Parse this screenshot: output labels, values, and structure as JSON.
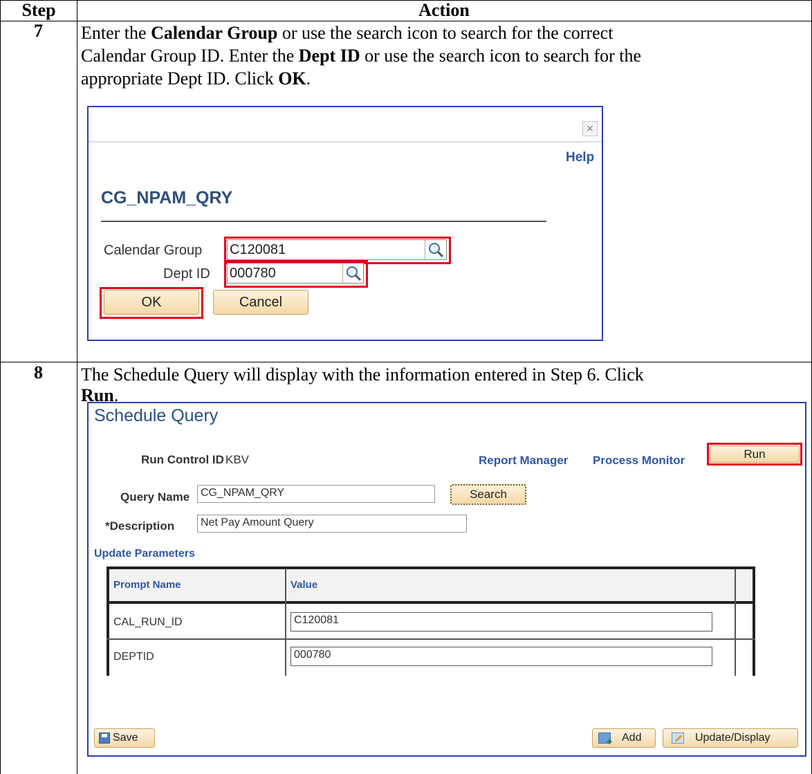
{
  "table": {
    "col_step": "Step",
    "col_action": "Action"
  },
  "step7": {
    "number": "7",
    "line1_a": "Enter the ",
    "line1_b": "Calendar Group",
    "line1_c": " or use the search icon to search for the correct",
    "line2_a": "Calendar Group ID.  Enter the ",
    "line2_b": "Dept ID",
    "line2_c": " or use the search icon to search for the",
    "line3_a": "appropriate Dept ID.  Click ",
    "line3_b": "OK",
    "line3_c": ".",
    "dialog": {
      "close": "×",
      "help": "Help",
      "title": "CG_NPAM_QRY",
      "calendar_group_label": "Calendar Group",
      "calendar_group_value": "C120081",
      "dept_id_label": "Dept ID",
      "dept_id_value": "000780",
      "ok": "OK",
      "cancel": "Cancel"
    }
  },
  "step8": {
    "number": "8",
    "line1": "The Schedule Query will display with the information entered in Step 6.  Click",
    "line2_b": "Run",
    "line2_c": ".",
    "screen": {
      "title": "Schedule Query",
      "run_control_label": "Run Control ID",
      "run_control_value": "KBV",
      "report_manager": "Report Manager",
      "process_monitor": "Process Monitor",
      "run": "Run",
      "query_name_label": "Query Name",
      "query_name_value": "CG_NPAM_QRY",
      "search": "Search",
      "description_label": "*Description",
      "description_value": "Net Pay Amount Query",
      "update_parameters": "Update Parameters",
      "grid_headers": [
        "Prompt Name",
        "Value"
      ],
      "grid_rows": [
        {
          "prompt": "CAL_RUN_ID",
          "value": "C120081"
        },
        {
          "prompt": "DEPTID",
          "value": "000780"
        }
      ],
      "save": "Save",
      "add": "Add",
      "update_display": "Update/Display"
    }
  }
}
